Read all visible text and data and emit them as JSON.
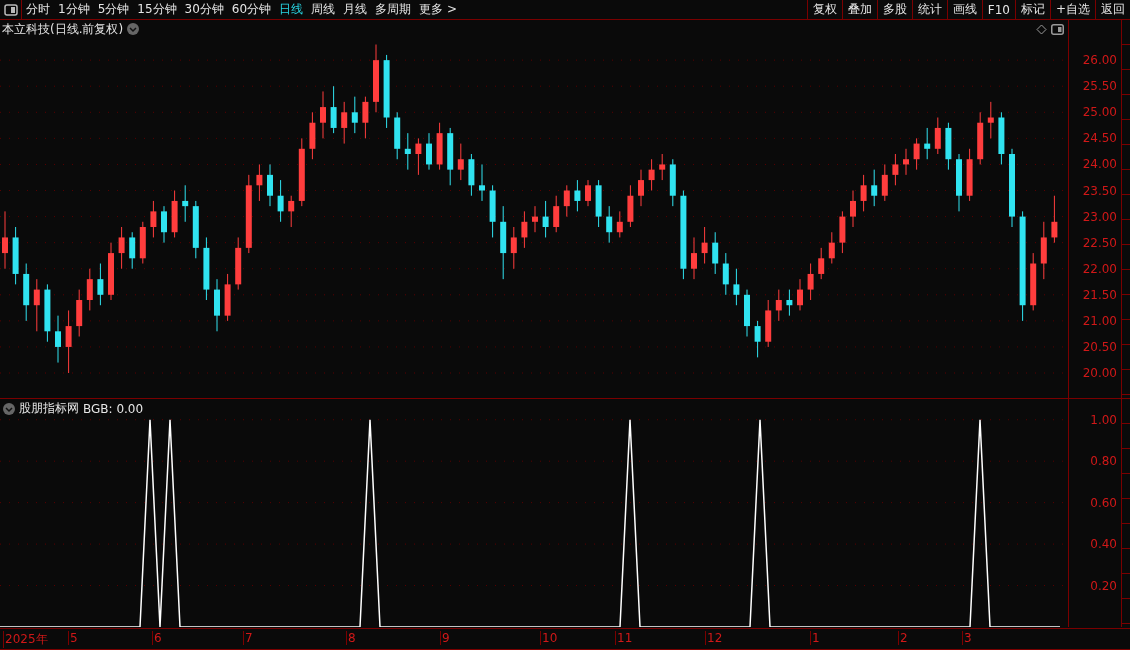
{
  "toolbar": {
    "periods": [
      {
        "label": "分时",
        "selected": false
      },
      {
        "label": "1分钟",
        "selected": false
      },
      {
        "label": "5分钟",
        "selected": false
      },
      {
        "label": "15分钟",
        "selected": false
      },
      {
        "label": "30分钟",
        "selected": false
      },
      {
        "label": "60分钟",
        "selected": false
      },
      {
        "label": "日线",
        "selected": true
      },
      {
        "label": "周线",
        "selected": false
      },
      {
        "label": "月线",
        "selected": false
      },
      {
        "label": "多周期",
        "selected": false
      },
      {
        "label": "更多 >",
        "selected": false
      }
    ],
    "buttons": [
      "复权",
      "叠加",
      "多股",
      "统计",
      "画线",
      "F10",
      "标记",
      "+自选",
      "返回"
    ]
  },
  "price_chart": {
    "title": "本立科技(日线.前复权)",
    "chart_data": {
      "type": "candlestick",
      "ylim": [
        19.54,
        26.77
      ],
      "grid": true,
      "yticks": [
        {
          "value": 26,
          "label": "26.00"
        },
        {
          "value": 25.5,
          "label": "25.50"
        },
        {
          "value": 25,
          "label": "25.00"
        },
        {
          "value": 24.5,
          "label": "24.50"
        },
        {
          "value": 24,
          "label": "24.00"
        },
        {
          "value": 23.5,
          "label": "23.50"
        },
        {
          "value": 23,
          "label": "23.00"
        },
        {
          "value": 22.5,
          "label": "22.50"
        },
        {
          "value": 22,
          "label": "22.00"
        },
        {
          "value": 21.5,
          "label": "21.50"
        },
        {
          "value": 21,
          "label": "21.00"
        },
        {
          "value": 20.5,
          "label": "20.50"
        },
        {
          "value": 20,
          "label": "20.00"
        }
      ],
      "ohlc": [
        [
          22.3,
          23.1,
          22.0,
          22.6
        ],
        [
          22.6,
          22.8,
          21.7,
          21.9
        ],
        [
          21.9,
          22.1,
          21.0,
          21.3
        ],
        [
          21.3,
          21.8,
          20.8,
          21.6
        ],
        [
          21.6,
          21.7,
          20.6,
          20.8
        ],
        [
          20.8,
          21.1,
          20.2,
          20.5
        ],
        [
          20.5,
          21.2,
          20.0,
          20.9
        ],
        [
          20.9,
          21.6,
          20.7,
          21.4
        ],
        [
          21.4,
          22.0,
          21.2,
          21.8
        ],
        [
          21.8,
          22.1,
          21.3,
          21.5
        ],
        [
          21.5,
          22.5,
          21.4,
          22.3
        ],
        [
          22.3,
          22.8,
          22.0,
          22.6
        ],
        [
          22.6,
          22.7,
          22.0,
          22.2
        ],
        [
          22.2,
          22.9,
          22.1,
          22.8
        ],
        [
          22.8,
          23.3,
          22.6,
          23.1
        ],
        [
          23.1,
          23.2,
          22.5,
          22.7
        ],
        [
          22.7,
          23.5,
          22.6,
          23.3
        ],
        [
          23.3,
          23.6,
          22.9,
          23.2
        ],
        [
          23.2,
          23.3,
          22.2,
          22.4
        ],
        [
          22.4,
          22.6,
          21.4,
          21.6
        ],
        [
          21.6,
          21.8,
          20.8,
          21.1
        ],
        [
          21.1,
          21.9,
          21.0,
          21.7
        ],
        [
          21.7,
          22.6,
          21.6,
          22.4
        ],
        [
          22.4,
          23.8,
          22.3,
          23.6
        ],
        [
          23.6,
          24.0,
          23.3,
          23.8
        ],
        [
          23.8,
          24.0,
          23.2,
          23.4
        ],
        [
          23.4,
          23.7,
          22.9,
          23.1
        ],
        [
          23.1,
          23.4,
          22.8,
          23.3
        ],
        [
          23.3,
          24.5,
          23.2,
          24.3
        ],
        [
          24.3,
          25.0,
          24.1,
          24.8
        ],
        [
          24.8,
          25.4,
          24.5,
          25.1
        ],
        [
          25.1,
          25.5,
          24.6,
          24.7
        ],
        [
          24.7,
          25.2,
          24.4,
          25.0
        ],
        [
          25.0,
          25.3,
          24.6,
          24.8
        ],
        [
          24.8,
          25.3,
          24.5,
          25.2
        ],
        [
          25.2,
          26.3,
          25.0,
          26.0
        ],
        [
          26.0,
          26.1,
          24.7,
          24.9
        ],
        [
          24.9,
          25.0,
          24.1,
          24.3
        ],
        [
          24.3,
          24.6,
          23.9,
          24.2
        ],
        [
          24.2,
          24.5,
          23.8,
          24.4
        ],
        [
          24.4,
          24.6,
          23.9,
          24.0
        ],
        [
          24.0,
          24.8,
          23.9,
          24.6
        ],
        [
          24.6,
          24.7,
          23.6,
          23.9
        ],
        [
          23.9,
          24.4,
          23.7,
          24.1
        ],
        [
          24.1,
          24.2,
          23.4,
          23.6
        ],
        [
          23.6,
          24.0,
          23.3,
          23.5
        ],
        [
          23.5,
          23.6,
          22.6,
          22.9
        ],
        [
          22.9,
          23.2,
          21.8,
          22.3
        ],
        [
          22.3,
          22.8,
          22.0,
          22.6
        ],
        [
          22.6,
          23.1,
          22.4,
          22.9
        ],
        [
          22.9,
          23.2,
          22.7,
          23.0
        ],
        [
          23.0,
          23.3,
          22.6,
          22.8
        ],
        [
          22.8,
          23.4,
          22.7,
          23.2
        ],
        [
          23.2,
          23.6,
          23.0,
          23.5
        ],
        [
          23.5,
          23.7,
          23.1,
          23.3
        ],
        [
          23.3,
          23.7,
          23.2,
          23.6
        ],
        [
          23.6,
          23.7,
          22.8,
          23.0
        ],
        [
          23.0,
          23.2,
          22.5,
          22.7
        ],
        [
          22.7,
          23.1,
          22.6,
          22.9
        ],
        [
          22.9,
          23.6,
          22.8,
          23.4
        ],
        [
          23.4,
          23.9,
          23.2,
          23.7
        ],
        [
          23.7,
          24.1,
          23.5,
          23.9
        ],
        [
          23.9,
          24.2,
          23.7,
          24.0
        ],
        [
          24.0,
          24.1,
          23.2,
          23.4
        ],
        [
          23.4,
          23.5,
          21.8,
          22.0
        ],
        [
          22.0,
          22.6,
          21.8,
          22.3
        ],
        [
          22.3,
          22.8,
          22.1,
          22.5
        ],
        [
          22.5,
          22.7,
          21.9,
          22.1
        ],
        [
          22.1,
          22.3,
          21.5,
          21.7
        ],
        [
          21.7,
          22.0,
          21.3,
          21.5
        ],
        [
          21.5,
          21.6,
          20.7,
          20.9
        ],
        [
          20.9,
          21.0,
          20.3,
          20.6
        ],
        [
          20.6,
          21.4,
          20.5,
          21.2
        ],
        [
          21.2,
          21.6,
          21.0,
          21.4
        ],
        [
          21.4,
          21.6,
          21.1,
          21.3
        ],
        [
          21.3,
          21.8,
          21.2,
          21.6
        ],
        [
          21.6,
          22.1,
          21.4,
          21.9
        ],
        [
          21.9,
          22.4,
          21.8,
          22.2
        ],
        [
          22.2,
          22.7,
          22.1,
          22.5
        ],
        [
          22.5,
          23.1,
          22.3,
          23.0
        ],
        [
          23.0,
          23.5,
          22.8,
          23.3
        ],
        [
          23.3,
          23.8,
          23.1,
          23.6
        ],
        [
          23.6,
          23.9,
          23.2,
          23.4
        ],
        [
          23.4,
          24.0,
          23.3,
          23.8
        ],
        [
          23.8,
          24.2,
          23.6,
          24.0
        ],
        [
          24.0,
          24.3,
          23.8,
          24.1
        ],
        [
          24.1,
          24.5,
          23.9,
          24.4
        ],
        [
          24.4,
          24.7,
          24.1,
          24.3
        ],
        [
          24.3,
          24.9,
          24.2,
          24.7
        ],
        [
          24.7,
          24.8,
          23.9,
          24.1
        ],
        [
          24.1,
          24.2,
          23.1,
          23.4
        ],
        [
          23.4,
          24.3,
          23.3,
          24.1
        ],
        [
          24.1,
          25.0,
          24.0,
          24.8
        ],
        [
          24.8,
          25.2,
          24.5,
          24.9
        ],
        [
          24.9,
          25.0,
          24.0,
          24.2
        ],
        [
          24.2,
          24.3,
          22.8,
          23.0
        ],
        [
          23.0,
          23.1,
          21.0,
          21.3
        ],
        [
          21.3,
          22.3,
          21.2,
          22.1
        ],
        [
          22.1,
          22.9,
          21.8,
          22.6
        ],
        [
          22.6,
          23.4,
          22.5,
          22.9
        ]
      ]
    }
  },
  "indicator": {
    "name": "股朋指标网",
    "reading": "BGB: 0.00",
    "chart_data": {
      "type": "line",
      "ylim": [
        0,
        1.1
      ],
      "grid": true,
      "yticks": [
        {
          "value": 0.2,
          "label": "0.20"
        },
        {
          "value": 0.4,
          "label": "0.40"
        },
        {
          "value": 0.6,
          "label": "0.60"
        },
        {
          "value": 0.8,
          "label": "0.80"
        },
        {
          "value": 1.0,
          "label": "1.00"
        }
      ],
      "series": [
        {
          "color": "#ffffff",
          "values": [
            0,
            0,
            0,
            0,
            0,
            0,
            0,
            0,
            0,
            0,
            0,
            0,
            0,
            0,
            0,
            1,
            0,
            1,
            0,
            0,
            0,
            0,
            0,
            0,
            0,
            0,
            0,
            0,
            0,
            0,
            0,
            0,
            0,
            0,
            0,
            0,
            0,
            1,
            0,
            0,
            0,
            0,
            0,
            0,
            0,
            0,
            0,
            0,
            0,
            0,
            0,
            0,
            0,
            0,
            0,
            0,
            0,
            0,
            0,
            0,
            0,
            0,
            0,
            1,
            0,
            0,
            0,
            0,
            0,
            0,
            0,
            0,
            0,
            0,
            0,
            0,
            1,
            0,
            0,
            0,
            0,
            0,
            0,
            0,
            0,
            0,
            0,
            0,
            0,
            0,
            0,
            0,
            0,
            0,
            0,
            0,
            0,
            0,
            1,
            0,
            0,
            0,
            0,
            0,
            0,
            0,
            0
          ]
        }
      ]
    }
  },
  "time_axis": [
    "2025年",
    "5",
    "6",
    "7",
    "8",
    "9",
    "10",
    "11",
    "12",
    "1",
    "2",
    "3"
  ]
}
